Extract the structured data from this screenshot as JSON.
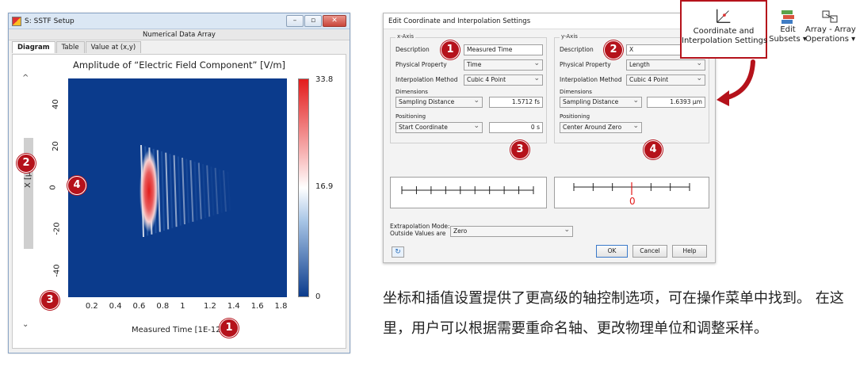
{
  "window": {
    "title": "S: SSTF Setup",
    "subtitle": "Numerical Data Array",
    "tabs": [
      "Diagram",
      "Table",
      "Value at (x,y)"
    ],
    "controls": [
      "–",
      "▫",
      "✕"
    ]
  },
  "plot": {
    "title": "Amplitude of “Electric Field Component”  [V/m]",
    "xlabel": "Measured Time [1E-12 s]",
    "ylabel": "X [μm]",
    "colorbar": [
      "33.8",
      "16.9",
      "0"
    ]
  },
  "chart_data": {
    "type": "heatmap",
    "title": "Amplitude of “Electric Field Component”  [V/m]",
    "xlabel": "Measured Time [1E-12 s]",
    "ylabel": "X [μm]",
    "x_ticks": [
      "0.2",
      "0.4",
      "0.6",
      "0.8",
      "1",
      "1.2",
      "1.4",
      "1.6",
      "1.8"
    ],
    "y_ticks": [
      "40",
      "20",
      "0",
      "-20",
      "-40"
    ],
    "colorbar_range": [
      0,
      33.8
    ],
    "colorbar_ticks": [
      "33.8",
      "16.9",
      "0"
    ],
    "colors": {
      "low": "#0b3b8c",
      "mid": "#ffffff",
      "high": "#e31b1b"
    }
  },
  "badges": {
    "b1": "1",
    "b2": "2",
    "b3": "3",
    "b4": "4"
  },
  "dialog": {
    "title": "Edit Coordinate and Interpolation Settings",
    "xaxis": {
      "group": "x-Axis",
      "description_label": "Description",
      "description_value": "Measured Time",
      "property_label": "Physical Property",
      "property_value": "Time",
      "interp_label": "Interpolation Method",
      "interp_value": "Cubic 4 Point",
      "dimensions_label": "Dimensions",
      "sampling_value": "Sampling Distance",
      "sampling_num": "1.5712 fs",
      "positioning_label": "Positioning",
      "position_value": "Start Coordinate",
      "position_num": "0 s"
    },
    "yaxis": {
      "group": "y-Axis",
      "description_label": "Description",
      "description_value": "X",
      "property_label": "Physical Property",
      "property_value": "Length",
      "interp_label": "Interpolation Method",
      "interp_value": "Cubic 4 Point",
      "dimensions_label": "Dimensions",
      "sampling_value": "Sampling Distance",
      "sampling_num": "1.6393 μm",
      "positioning_label": "Positioning",
      "position_value": "Center Around Zero"
    },
    "ruler_zero": "0",
    "extrapolation_label": "Extrapolation Mode:\nOutside Values are",
    "extrapolation_value": "Zero",
    "ok": "OK",
    "cancel": "Cancel",
    "help": "Help"
  },
  "ribbon": {
    "coord": "Coordinate and\nInterpolation Settings",
    "edit": "Edit\nSubsets ▾",
    "array": "Array - Array\nOperations ▾"
  },
  "description_cn": "坐标和插值设置提供了更高级的轴控制选项，可在操作菜单中找到。 在这里，用户可以根据需要重命名轴、更改物理单位和调整采样。"
}
